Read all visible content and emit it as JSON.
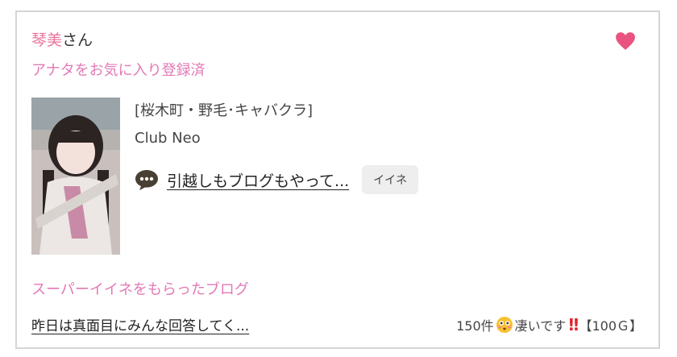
{
  "header": {
    "name": "琴美",
    "honorific": "さん",
    "favorite_status": "アナタをお気に入り登録済"
  },
  "profile": {
    "area": "[桜木町・野毛･キャバクラ]",
    "shop": "Club Neo",
    "blog_title": "引越しもブログもやって...",
    "iine_label": "イイネ"
  },
  "super_iine": {
    "heading": "スーパーイイネをもらったブログ",
    "blog_title": "昨日は真面目にみんな回答してく...",
    "count": "150件",
    "reaction": "凄いです",
    "points": "【100Ｇ】"
  },
  "icons": {
    "heart": "heart-icon",
    "comment": "speech-bubble-icon",
    "emoji": "flushed-face-emoji",
    "exclamation": "double-exclamation-icon"
  },
  "colors": {
    "accent_pink": "#e279b5",
    "name_pink": "#e9739a",
    "heart": "#e8547f",
    "exclamation_red": "#e0232b"
  }
}
